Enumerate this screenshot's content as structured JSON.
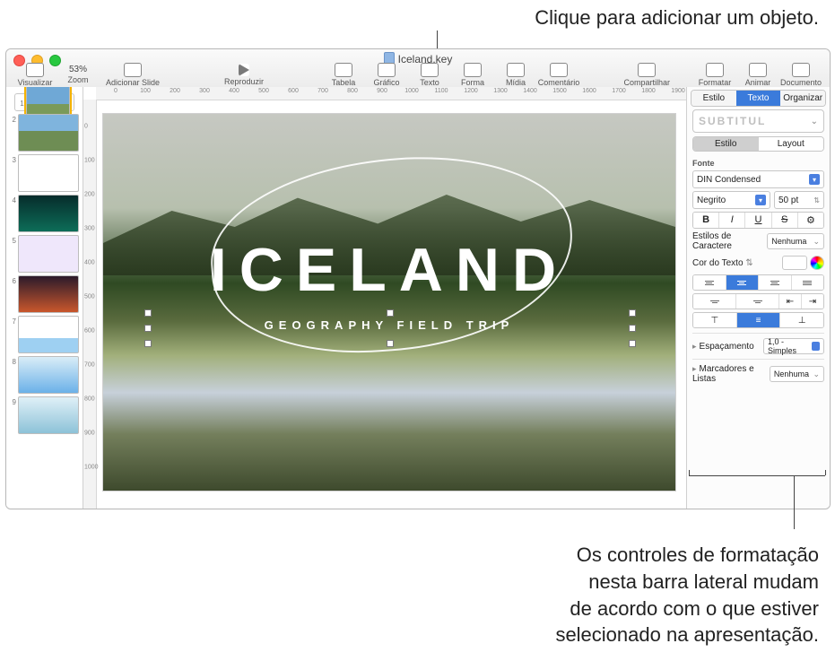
{
  "callouts": {
    "top": "Clique para adicionar um objeto.",
    "bottom": "Os controles de formatação\nnesta barra lateral mudam\nde acordo com o que estiver\nselecionado na apresentação."
  },
  "window_title": "Iceland.key",
  "toolbar": {
    "view": "Visualizar",
    "zoom": "Zoom",
    "zoom_value": "53%",
    "add_slide": "Adicionar Slide",
    "play": "Reproduzir",
    "table": "Tabela",
    "chart": "Gráfico",
    "text": "Texto",
    "shape": "Forma",
    "media": "Mídia",
    "comment": "Comentário",
    "share": "Compartilhar",
    "format": "Formatar",
    "animate": "Animar",
    "document": "Documento"
  },
  "ruler_h": [
    "0",
    "100",
    "200",
    "300",
    "400",
    "500",
    "600",
    "700",
    "800",
    "900",
    "1000",
    "1100",
    "1200",
    "1300",
    "1400",
    "1500",
    "1600",
    "1700",
    "1800",
    "1900"
  ],
  "ruler_v": [
    "0",
    "100",
    "200",
    "300",
    "400",
    "500",
    "600",
    "700",
    "800",
    "900",
    "1000"
  ],
  "nav_numbers": [
    "1",
    "2",
    "3",
    "4",
    "5",
    "6",
    "7",
    "8",
    "9"
  ],
  "slide": {
    "title": "ICELAND",
    "subtitle": "GEOGRAPHY FIELD TRIP"
  },
  "inspector": {
    "tabs": {
      "style": "Estilo",
      "text": "Texto",
      "arrange": "Organizar"
    },
    "paragraph_style": "SUBTITUL",
    "subtabs": {
      "style": "Estilo",
      "layout": "Layout"
    },
    "font_label": "Fonte",
    "font_family": "DIN Condensed",
    "font_weight": "Negrito",
    "font_size": "50 pt",
    "bold": "B",
    "italic": "I",
    "underline": "U",
    "strike": "S",
    "char_styles_label": "Estilos de Caractere",
    "char_styles_value": "Nenhuma",
    "text_color_label": "Cor do Texto",
    "spacing_label": "Espaçamento",
    "spacing_value": "1,0 - Simples",
    "bullets_label": "Marcadores e Listas",
    "bullets_value": "Nenhuma"
  }
}
